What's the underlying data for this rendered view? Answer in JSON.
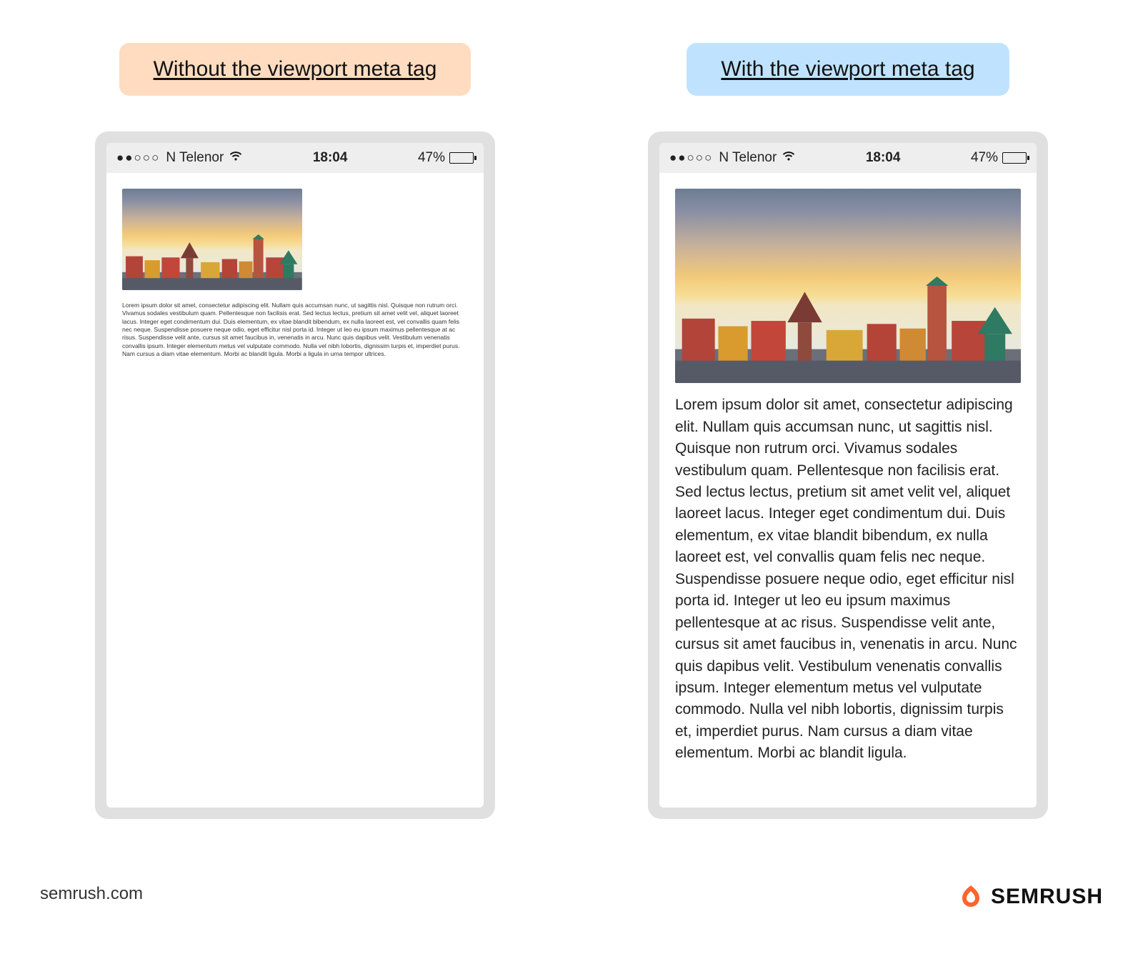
{
  "left": {
    "label": "Without the viewport meta tag"
  },
  "right": {
    "label": "With the viewport meta tag"
  },
  "statusbar": {
    "dots": "●●○○○",
    "carrier": "N Telenor",
    "time": "18:04",
    "battery_pct": "47%"
  },
  "body_text": "Lorem ipsum dolor sit amet, consectetur adipiscing elit. Nullam quis accumsan nunc, ut sagittis nisl. Quisque non rutrum orci. Vivamus sodales vestibulum quam. Pellentesque non facilisis erat. Sed lectus lectus, pretium sit amet velit vel, aliquet laoreet lacus. Integer eget condimentum dui. Duis elementum, ex vitae blandit bibendum, ex nulla laoreet est, vel convallis quam felis nec neque. Suspendisse posuere neque odio, eget efficitur nisl porta id. Integer ut leo eu ipsum maximus pellentesque at ac risus. Suspendisse velit ante, cursus sit amet faucibus in, venenatis in arcu. Nunc quis dapibus velit. Vestibulum venenatis convallis ipsum. Integer elementum metus vel vulputate commodo. Nulla vel nibh lobortis, dignissim turpis et, imperdiet purus. Nam cursus a diam vitae elementum. Morbi ac blandit ligula.",
  "body_text_small_extra": " Morbi a ligula in urna tempor ultrices.",
  "footer": {
    "url": "semrush.com",
    "brand": "SEMRUSH"
  }
}
